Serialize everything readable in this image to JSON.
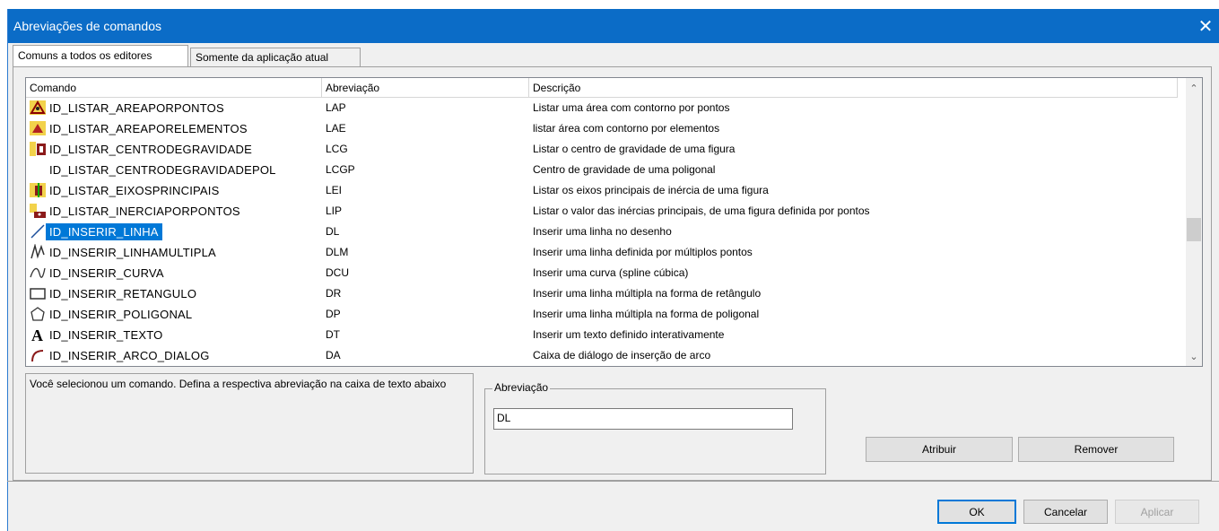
{
  "window": {
    "title": "Abreviações de comandos",
    "close_glyph": "✕"
  },
  "tabs": [
    {
      "label": "Comuns a todos os editores",
      "active": true
    },
    {
      "label": "Somente da aplicação atual",
      "active": false
    }
  ],
  "list": {
    "columns": [
      "Comando",
      "Abreviação",
      "Descrição"
    ],
    "rows": [
      {
        "icon": "area-points-icon",
        "command": "ID_LISTAR_AREAPORPONTOS",
        "abbr": "LAP",
        "desc": "Listar uma área com contorno por pontos"
      },
      {
        "icon": "area-elements-icon",
        "command": "ID_LISTAR_AREAPORELEMENTOS",
        "abbr": "LAE",
        "desc": "listar área com contorno por elementos"
      },
      {
        "icon": "center-gravity-icon",
        "command": "ID_LISTAR_CENTRODEGRAVIDADE",
        "abbr": "LCG",
        "desc": "Listar o centro de gravidade de uma figura"
      },
      {
        "icon": "",
        "command": "ID_LISTAR_CENTRODEGRAVIDADEPOL",
        "abbr": "LCGP",
        "desc": "Centro de gravidade de uma poligonal"
      },
      {
        "icon": "principal-axes-icon",
        "command": "ID_LISTAR_EIXOSPRINCIPAIS",
        "abbr": "LEI",
        "desc": "Listar os eixos principais de inércia de uma figura"
      },
      {
        "icon": "inertia-points-icon",
        "command": "ID_LISTAR_INERCIAPORPONTOS",
        "abbr": "LIP",
        "desc": "Listar o valor das inércias principais, de uma figura definida por pontos"
      },
      {
        "icon": "line-icon",
        "command": "ID_INSERIR_LINHA",
        "abbr": "DL",
        "desc": "Inserir uma linha no desenho",
        "selected": true
      },
      {
        "icon": "polyline-icon",
        "command": "ID_INSERIR_LINHAMULTIPLA",
        "abbr": "DLM",
        "desc": "Inserir uma linha definida por múltiplos pontos"
      },
      {
        "icon": "curve-icon",
        "command": "ID_INSERIR_CURVA",
        "abbr": "DCU",
        "desc": "Inserir uma curva (spline cúbica)"
      },
      {
        "icon": "rectangle-icon",
        "command": "ID_INSERIR_RETANGULO",
        "abbr": "DR",
        "desc": "Inserir uma linha múltipla na forma de retângulo"
      },
      {
        "icon": "polygon-icon",
        "command": "ID_INSERIR_POLIGONAL",
        "abbr": "DP",
        "desc": "Inserir uma linha múltipla na forma de poligonal"
      },
      {
        "icon": "text-icon",
        "command": "ID_INSERIR_TEXTO",
        "abbr": "DT",
        "desc": "Inserir um texto definido interativamente"
      },
      {
        "icon": "arc-icon",
        "command": "ID_INSERIR_ARCO_DIALOG",
        "abbr": "DA",
        "desc": "Caixa de diálogo de inserção de arco"
      }
    ],
    "scroll_up": "⌃",
    "scroll_down": "⌄"
  },
  "info_text": "Você selecionou um comando. Defina a respectiva abreviação na caixa de texto abaixo",
  "abbreviation": {
    "label": "Abreviação",
    "value": "DL"
  },
  "buttons": {
    "assign": "Atribuir",
    "remove": "Remover",
    "ok": "OK",
    "cancel": "Cancelar",
    "apply": "Aplicar"
  }
}
